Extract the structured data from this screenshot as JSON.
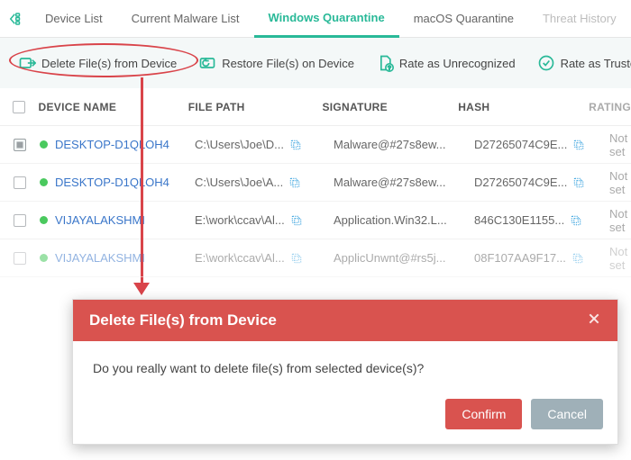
{
  "tabs": {
    "back_icon": "back-tree-icon",
    "items": [
      {
        "label": "Device List"
      },
      {
        "label": "Current Malware List"
      },
      {
        "label": "Windows Quarantine",
        "active": true
      },
      {
        "label": "macOS Quarantine"
      },
      {
        "label": "Threat History"
      }
    ]
  },
  "toolbar": {
    "delete_label": "Delete File(s) from Device",
    "restore_label": "Restore File(s) on Device",
    "rate_unrec_label": "Rate as Unrecognized",
    "rate_trusted_label": "Rate as Trusted"
  },
  "table": {
    "headers": {
      "name": "DEVICE NAME",
      "path": "FILE PATH",
      "sig": "SIGNATURE",
      "hash": "HASH",
      "rating": "RATING"
    },
    "rows": [
      {
        "checked": "indeterminate",
        "name": "DESKTOP-D1QLOH4",
        "path": "C:\\Users\\Joe\\D...",
        "sig": "Malware@#27s8ew...",
        "hash": "D27265074C9E...",
        "rating": "Not set"
      },
      {
        "checked": "none",
        "name": "DESKTOP-D1QLOH4",
        "path": "C:\\Users\\Joe\\A...",
        "sig": "Malware@#27s8ew...",
        "hash": "D27265074C9E...",
        "rating": "Not set"
      },
      {
        "checked": "none",
        "name": "VIJAYALAKSHMI",
        "path": "E:\\work\\ccav\\Al...",
        "sig": "Application.Win32.L...",
        "hash": "846C130E1155...",
        "rating": "Not set"
      },
      {
        "checked": "none",
        "name": "VIJAYALAKSHMI",
        "path": "E:\\work\\ccav\\Al...",
        "sig": "ApplicUnwnt@#rs5j...",
        "hash": "08F107AA9F17...",
        "rating": "Not set",
        "faded": true
      }
    ]
  },
  "modal": {
    "title": "Delete File(s) from Device",
    "body": "Do you really want to delete file(s) from selected device(s)?",
    "confirm": "Confirm",
    "cancel": "Cancel"
  }
}
